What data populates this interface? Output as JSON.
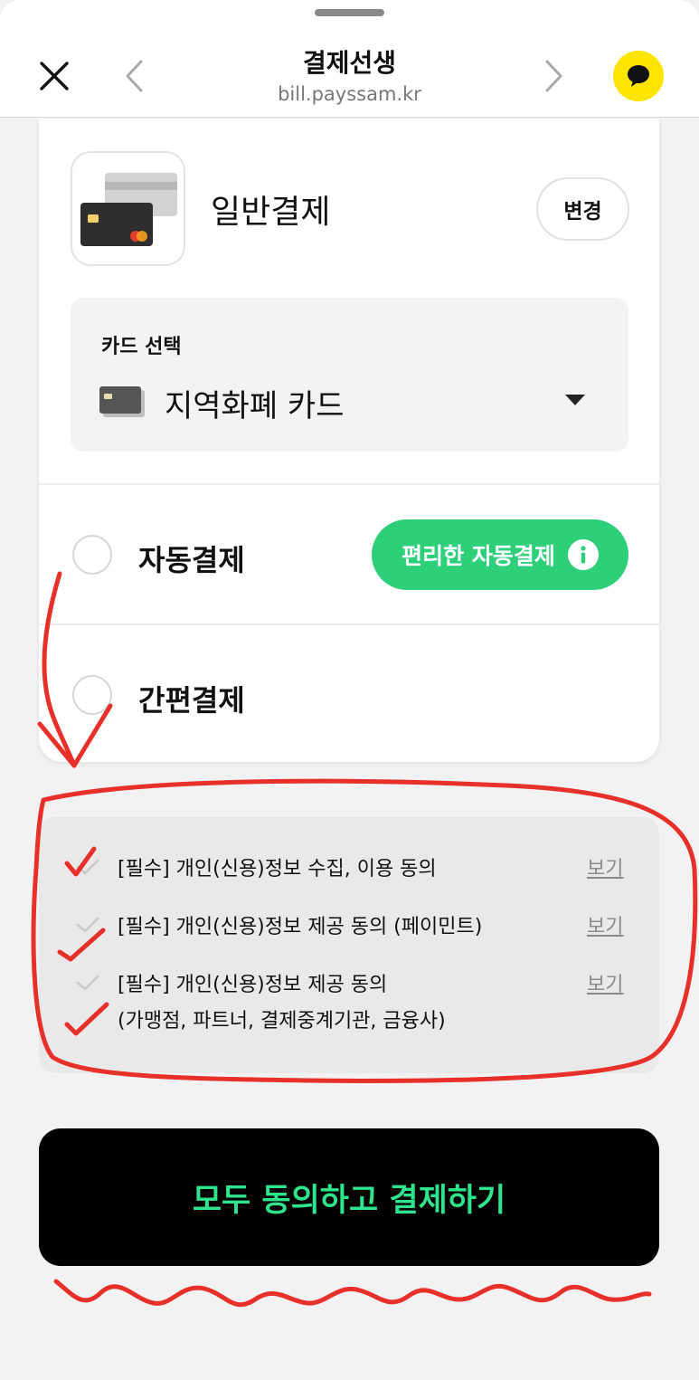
{
  "header": {
    "title": "결제선생",
    "url": "bill.payssam.kr"
  },
  "payment_method": {
    "label": "일반결제",
    "change_label": "변경"
  },
  "card_select": {
    "label": "카드 선택",
    "value": "지역화폐 카드"
  },
  "options": [
    {
      "label": "자동결제",
      "badge": "편리한 자동결제"
    },
    {
      "label": "간편결제"
    }
  ],
  "terms": [
    {
      "text": "[필수] 개인(신용)정보 수집, 이용 동의",
      "link": "보기"
    },
    {
      "text": "[필수] 개인(신용)정보 제공 동의 (페이민트)",
      "link": "보기"
    },
    {
      "text": "[필수] 개인(신용)정보 제공 동의",
      "text2": "(가맹점, 파트너, 결제중계기관, 금융사)",
      "link": "보기"
    }
  ],
  "pay_button": "모두 동의하고 결제하기",
  "colors": {
    "accent_green": "#2dcf78",
    "pay_text_green": "#2ee58d",
    "kakao_yellow": "#fee500",
    "annotation_red": "#e8302a"
  }
}
